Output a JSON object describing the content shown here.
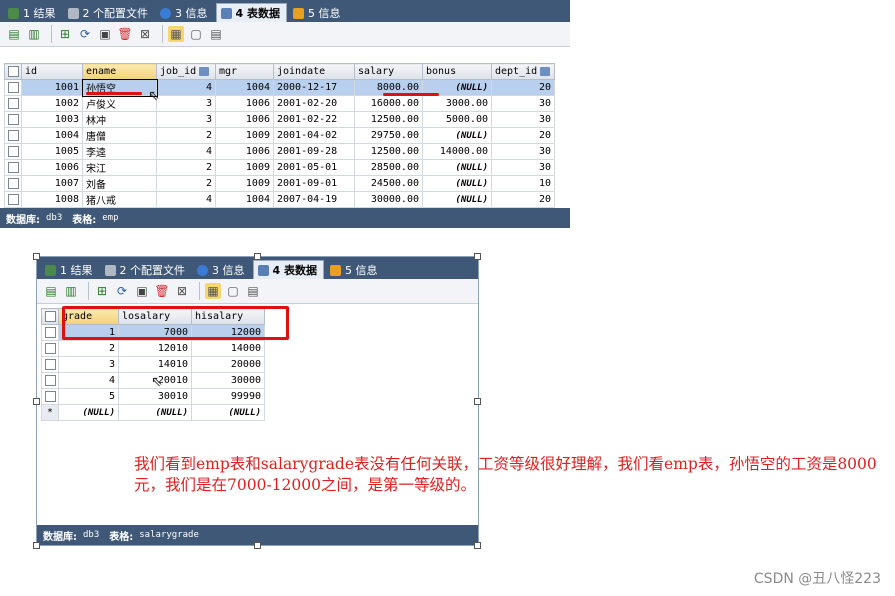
{
  "tabs": [
    {
      "label": "1 结果",
      "icon": "grid-icon"
    },
    {
      "label": "2 个配置文件",
      "icon": "profile-icon"
    },
    {
      "label": "3 信息",
      "icon": "info-icon"
    },
    {
      "label": "4 表数据",
      "icon": "table-data-icon"
    },
    {
      "label": "5 信息",
      "icon": "info2-icon"
    }
  ],
  "emp": {
    "columns": [
      "id",
      "ename",
      "job_id",
      "mgr",
      "joindate",
      "salary",
      "bonus",
      "dept_id"
    ],
    "rows": [
      [
        "1001",
        "孙悟空",
        "4",
        "1004",
        "2000-12-17",
        "8000.00",
        "(NULL)",
        "20"
      ],
      [
        "1002",
        "卢俊义",
        "3",
        "1006",
        "2001-02-20",
        "16000.00",
        "3000.00",
        "30"
      ],
      [
        "1003",
        "林冲",
        "3",
        "1006",
        "2001-02-22",
        "12500.00",
        "5000.00",
        "30"
      ],
      [
        "1004",
        "唐僧",
        "2",
        "1009",
        "2001-04-02",
        "29750.00",
        "(NULL)",
        "20"
      ],
      [
        "1005",
        "李逵",
        "4",
        "1006",
        "2001-09-28",
        "12500.00",
        "14000.00",
        "30"
      ],
      [
        "1006",
        "宋江",
        "2",
        "1009",
        "2001-05-01",
        "28500.00",
        "(NULL)",
        "30"
      ],
      [
        "1007",
        "刘备",
        "2",
        "1009",
        "2001-09-01",
        "24500.00",
        "(NULL)",
        "10"
      ],
      [
        "1008",
        "猪八戒",
        "4",
        "1004",
        "2007-04-19",
        "30000.00",
        "(NULL)",
        "20"
      ]
    ],
    "status": {
      "db_label": "数据库:",
      "db": "db3",
      "table_label": "表格:",
      "table": "emp"
    }
  },
  "salarygrade": {
    "columns": [
      "grade",
      "losalary",
      "hisalary"
    ],
    "rows": [
      [
        "1",
        "7000",
        "12000"
      ],
      [
        "2",
        "12010",
        "14000"
      ],
      [
        "3",
        "14010",
        "20000"
      ],
      [
        "4",
        "20010",
        "30000"
      ],
      [
        "5",
        "30010",
        "99990"
      ],
      [
        "(NULL)",
        "(NULL)",
        "(NULL)"
      ]
    ],
    "new_row_marker": "*",
    "status": {
      "db_label": "数据库:",
      "db": "db3",
      "table_label": "表格:",
      "table": "salarygrade"
    }
  },
  "annotation": "我们看到emp表和salarygrade表没有任何关联，工资等级很好理解，我们看emp表，孙悟空的工资是8000元，我们是在7000-12000之间，是第一等级的。",
  "watermark": "CSDN @丑八怪223",
  "colors": {
    "tabbar": "#3f5878",
    "annotation": "#e02020",
    "highlight_box": "#e01010",
    "selected_row": "#b8d0ee"
  }
}
